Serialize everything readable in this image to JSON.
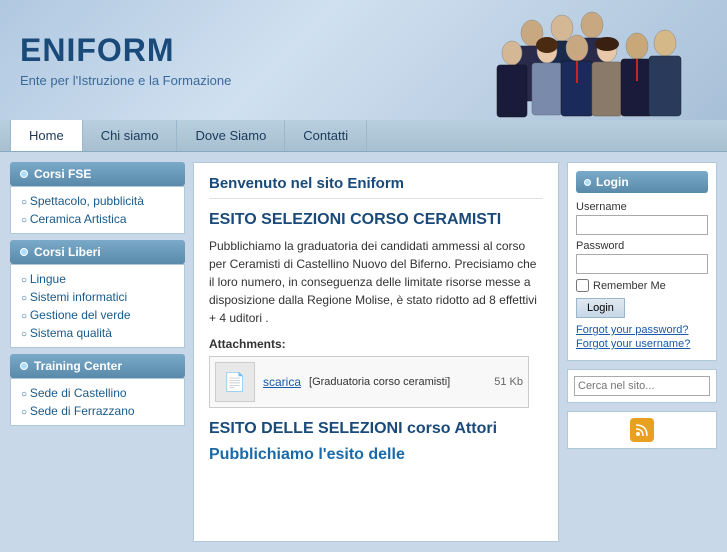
{
  "header": {
    "title": "ENIFORM",
    "subtitle": "Ente per l'Istruzione e la Formazione"
  },
  "nav": {
    "items": [
      {
        "label": "Home",
        "active": true
      },
      {
        "label": "Chi siamo",
        "active": false
      },
      {
        "label": "Dove Siamo",
        "active": false
      },
      {
        "label": "Contatti",
        "active": false
      }
    ]
  },
  "sidebar": {
    "sections": [
      {
        "id": "corsi-fse",
        "header": "Corsi FSE",
        "links": [
          {
            "label": "Spettacolo, pubblicità"
          },
          {
            "label": "Ceramica Artistica"
          }
        ]
      },
      {
        "id": "corsi-liberi",
        "header": "Corsi Liberi",
        "links": [
          {
            "label": "Lingue"
          },
          {
            "label": "Sistemi informatici"
          },
          {
            "label": "Gestione del verde"
          },
          {
            "label": "Sistema qualità"
          }
        ]
      },
      {
        "id": "training-center",
        "header": "Training Center",
        "links": [
          {
            "label": "Sede di Castellino"
          },
          {
            "label": "Sede di Ferrazzano"
          }
        ]
      }
    ]
  },
  "content": {
    "welcome": "Benvenuto nel sito Eniform",
    "section1_title": "ESITO SELEZIONI CORSO CERAMISTI",
    "section1_text": "Pubblichiamo la graduatoria dei candidati ammessi al corso per Ceramisti di Castellino Nuovo del Biferno. Precisiamo che il loro numero, in conseguenza delle limitate risorse messe a disposizione dalla Regione Molise, è stato ridotto ad 8 effettivi + 4 uditori .",
    "attachments_label": "Attachments:",
    "attachment": {
      "name": "[Graduatoria corso ceramisti]",
      "size": "51 Kb",
      "download_label": "scarica"
    },
    "section2_title": "ESITO DELLE SELEZIONI corso Attori",
    "section3_title": "Pubblichiamo l'esito delle"
  },
  "right_sidebar": {
    "login": {
      "header": "Login",
      "username_label": "Username",
      "password_label": "Password",
      "remember_label": "Remember Me",
      "button_label": "Login",
      "forgot_password": "Forgot your password?",
      "forgot_username": "Forgot your username?"
    },
    "search": {
      "placeholder": "Cerca nel sito..."
    },
    "rss_icon": "rss"
  }
}
